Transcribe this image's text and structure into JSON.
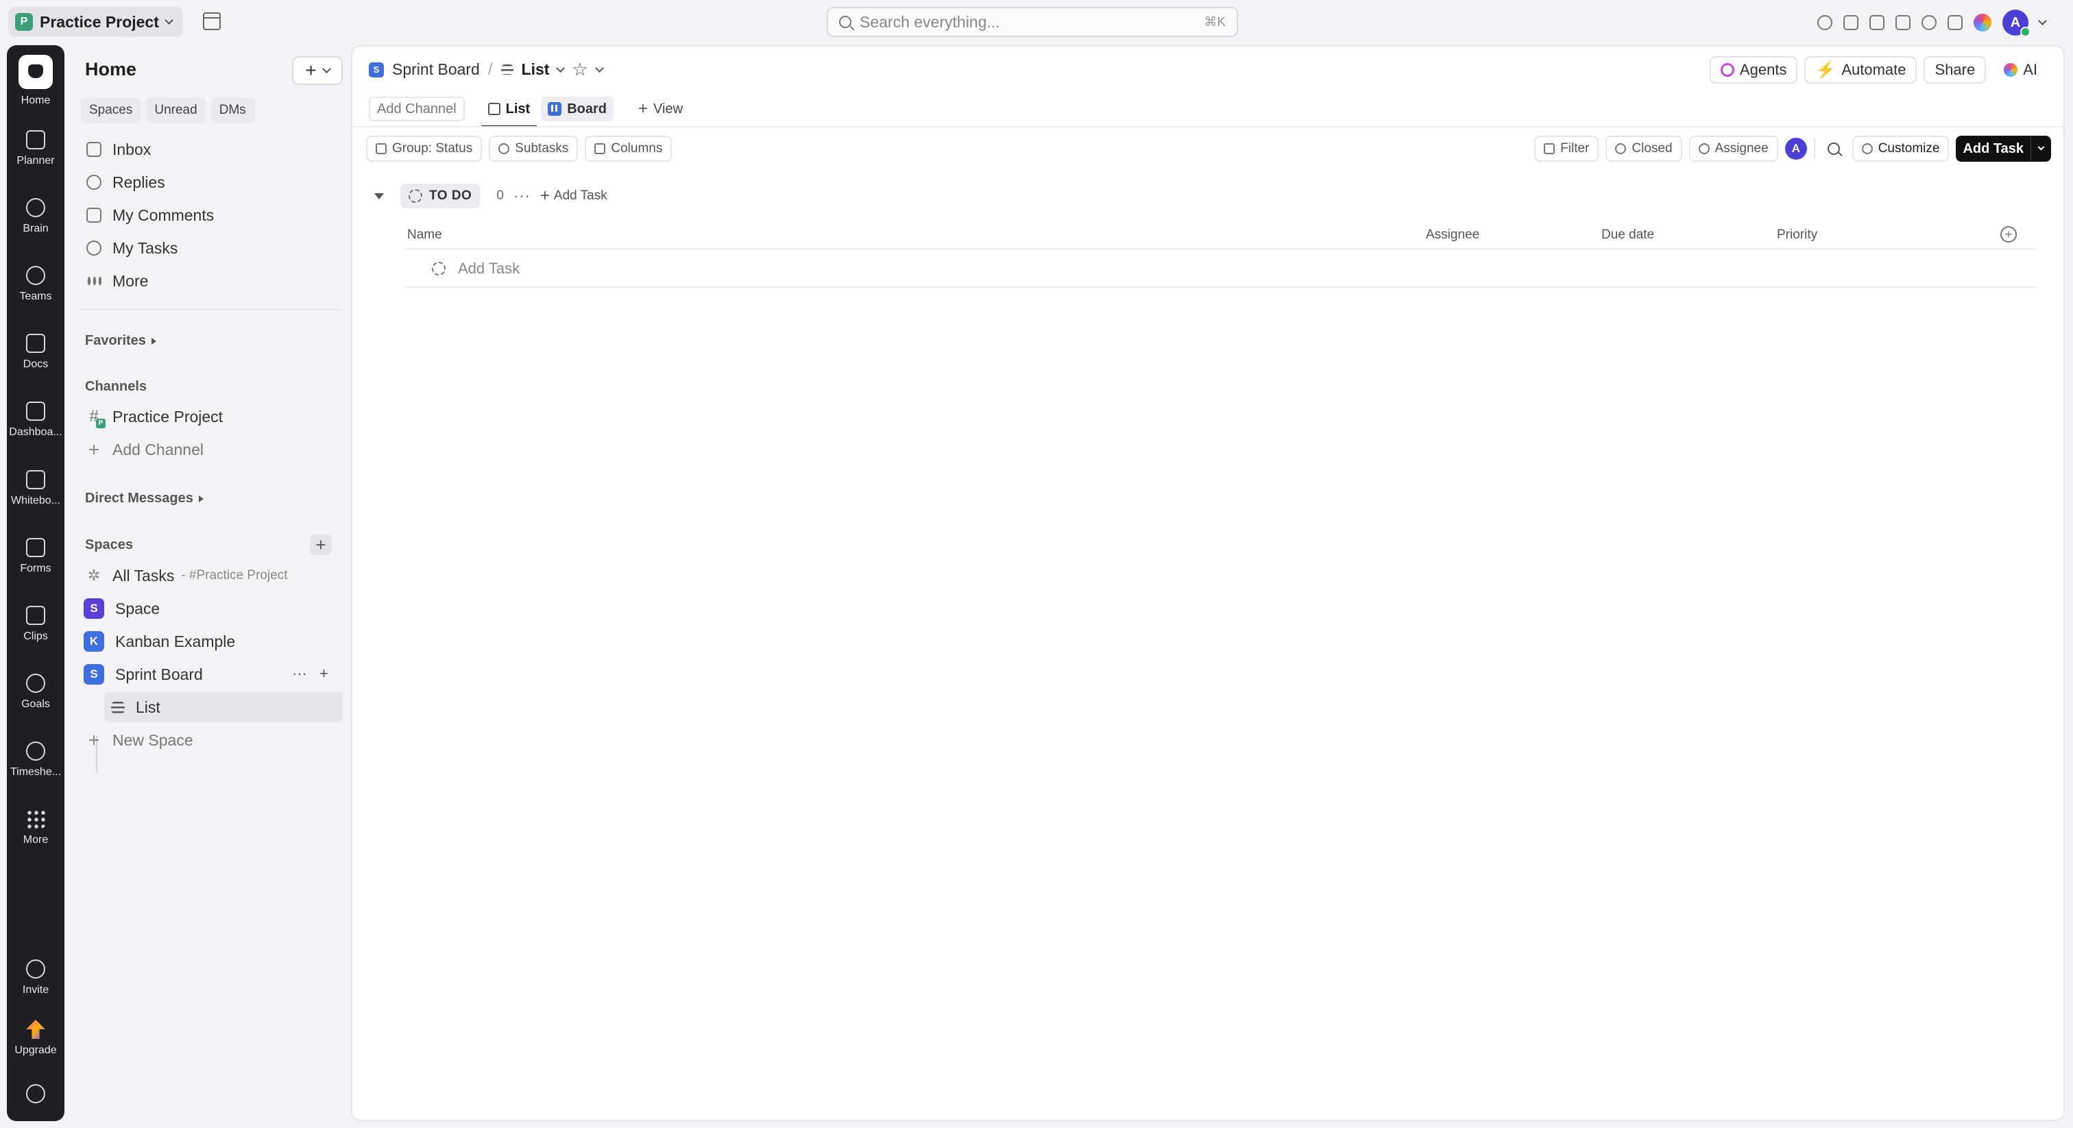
{
  "topbar": {
    "workspace_initial": "P",
    "workspace_name": "Practice Project",
    "search_placeholder": "Search everything...",
    "search_shortcut": "⌘K",
    "user_initial": "A"
  },
  "rail": {
    "items": [
      {
        "label": "Home",
        "icon": "home-icon"
      },
      {
        "label": "Planner",
        "icon": "calendar-icon"
      },
      {
        "label": "Brain",
        "icon": "brain-icon"
      },
      {
        "label": "Teams",
        "icon": "teams-icon"
      },
      {
        "label": "Docs",
        "icon": "doc-icon"
      },
      {
        "label": "Dashboa...",
        "icon": "dashboard-icon"
      },
      {
        "label": "Whitebo...",
        "icon": "whiteboard-icon"
      },
      {
        "label": "Forms",
        "icon": "forms-icon"
      },
      {
        "label": "Clips",
        "icon": "video-icon"
      },
      {
        "label": "Goals",
        "icon": "trophy-icon"
      },
      {
        "label": "Timeshe...",
        "icon": "clock-icon"
      },
      {
        "label": "More",
        "icon": "grid-icon"
      }
    ],
    "invite_label": "Invite",
    "upgrade_label": "Upgrade"
  },
  "sidebar": {
    "title": "Home",
    "tabs": [
      "Spaces",
      "Unread",
      "DMs"
    ],
    "nav": [
      {
        "label": "Inbox"
      },
      {
        "label": "Replies"
      },
      {
        "label": "My Comments"
      },
      {
        "label": "My Tasks"
      },
      {
        "label": "More"
      }
    ],
    "favorites_label": "Favorites",
    "channels_label": "Channels",
    "channels": [
      {
        "label": "Practice Project"
      }
    ],
    "add_channel_label": "Add Channel",
    "dms_label": "Direct Messages",
    "spaces_label": "Spaces",
    "all_tasks_label": "All Tasks",
    "all_tasks_sub": "- #Practice Project",
    "spaces": [
      {
        "initial": "S",
        "label": "Space",
        "color": "#5b3fd6"
      },
      {
        "initial": "K",
        "label": "Kanban Example",
        "color": "#3d6fe0"
      },
      {
        "initial": "S",
        "label": "Sprint Board",
        "color": "#3d6fe0"
      }
    ],
    "list_label": "List",
    "new_space_label": "New Space"
  },
  "main": {
    "crumb_space_initial": "S",
    "crumb_space": "Sprint Board",
    "crumb_sep": "/",
    "crumb_list": "List",
    "agents_label": "Agents",
    "automate_label": "Automate",
    "share_label": "Share",
    "ai_label": "AI",
    "add_channel_label": "Add Channel",
    "view_list_label": "List",
    "view_board_label": "Board",
    "add_view_label": "View",
    "group_label": "Group: Status",
    "subtasks_label": "Subtasks",
    "columns_label": "Columns",
    "filter_label": "Filter",
    "closed_label": "Closed",
    "assignee_label": "Assignee",
    "assignee_initial": "A",
    "customize_label": "Customize",
    "add_task_label": "Add Task",
    "group": {
      "status": "TO DO",
      "count": "0",
      "add_label": "Add Task"
    },
    "columns": [
      "Name",
      "Assignee",
      "Due date",
      "Priority"
    ],
    "add_row_label": "Add Task"
  }
}
